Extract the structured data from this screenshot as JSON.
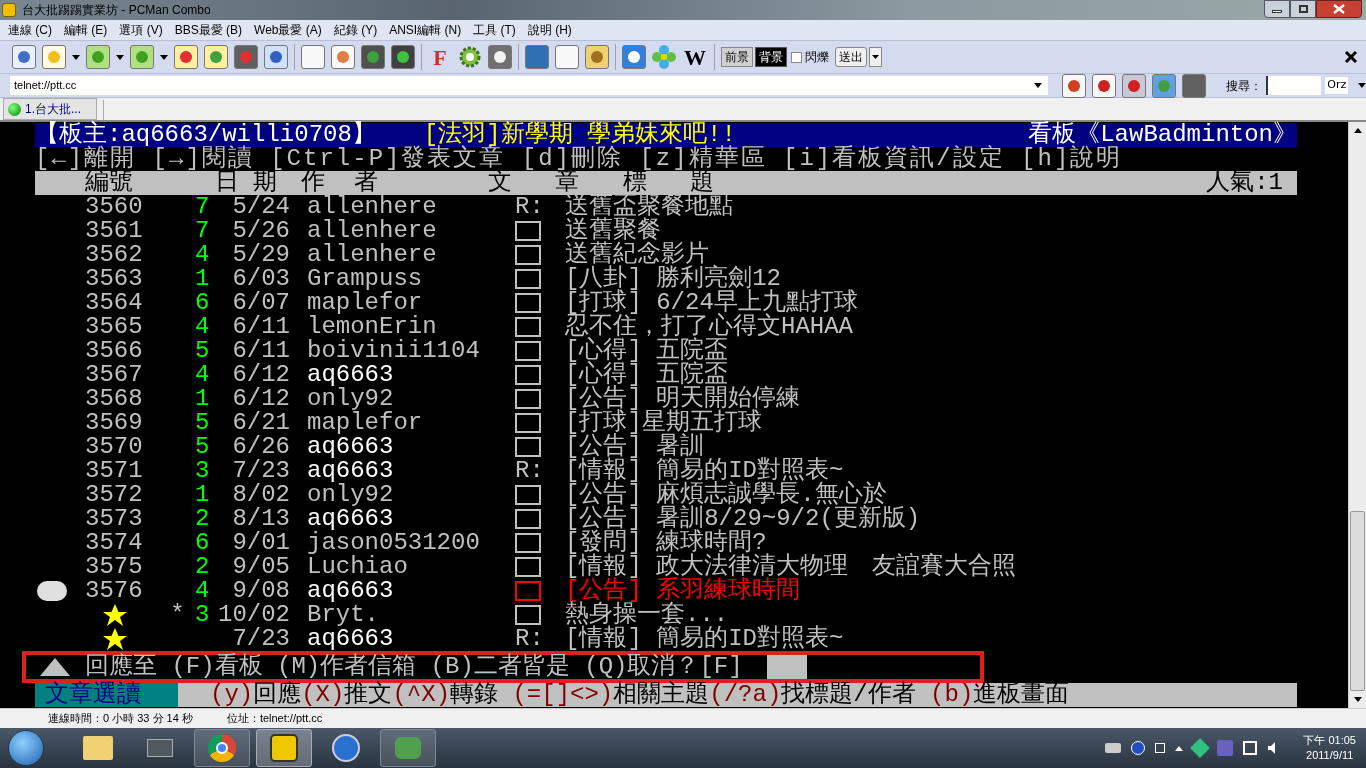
{
  "window": {
    "title": "台大批踢踢實業坊 - PCMan Combo"
  },
  "menu": [
    "連線 (C)",
    "編輯 (E)",
    "選項 (V)",
    "BBS最愛 (B)",
    "Web最愛 (A)",
    "紀錄 (Y)",
    "ANSI編輯 (N)",
    "工具 (T)",
    "說明 (H)"
  ],
  "toolbar": {
    "font_letter": "F",
    "wiki_letter": "W",
    "color_buttons": [
      {
        "label": "前景",
        "selected": false
      },
      {
        "label": "背景",
        "selected": true
      }
    ],
    "blink": {
      "label": "閃爍",
      "checked": false
    },
    "send_button": "送出"
  },
  "address_bar": {
    "value": "telnet://ptt.cc"
  },
  "search": {
    "label": "搜尋：",
    "engine": "Orz"
  },
  "tabs": [
    {
      "label": "1.台大批...",
      "selected": true
    }
  ],
  "terminal": {
    "header": {
      "moderators": "【板主:aq6663/willi0708】",
      "board_title": "[法羽]新學期 學弟妹來吧!!",
      "board_name": "看板《LawBadminton》"
    },
    "commands": "[←]離開 [→]閱讀 [Ctrl-P]發表文章 [d]刪除 [z]精華區 [i]看板資訊/設定 [h]說明",
    "columns": [
      "編號",
      "日 期",
      "作  者",
      "文   章   標   題"
    ],
    "popularity": "人氣:1",
    "rows": [
      {
        "number": "3560",
        "push": "7",
        "date": "5/24",
        "author": "allenhere",
        "kind": "reply",
        "prefix": "R:",
        "title": "送舊盃聚餐地點",
        "selected": false,
        "pinned": false,
        "bright": false,
        "color": "#c0c0c0"
      },
      {
        "number": "3561",
        "push": "7",
        "date": "5/26",
        "author": "allenhere",
        "kind": "post",
        "title": "送舊聚餐",
        "selected": false,
        "pinned": false,
        "bright": false,
        "color": "#c0c0c0"
      },
      {
        "number": "3562",
        "push": "4",
        "date": "5/29",
        "author": "allenhere",
        "kind": "post",
        "title": "送舊紀念影片",
        "selected": false,
        "pinned": false,
        "bright": false,
        "color": "#c0c0c0"
      },
      {
        "number": "3563",
        "push": "1",
        "date": "6/03",
        "author": "Grampuss",
        "kind": "post",
        "title": "[八卦] 勝利亮劍12",
        "selected": false,
        "pinned": false,
        "bright": false,
        "color": "#c0c0c0"
      },
      {
        "number": "3564",
        "push": "6",
        "date": "6/07",
        "author": "maplefor",
        "kind": "post",
        "title": "[打球] 6/24早上九點打球",
        "selected": false,
        "pinned": false,
        "bright": false,
        "color": "#c0c0c0"
      },
      {
        "number": "3565",
        "push": "4",
        "date": "6/11",
        "author": "lemonErin",
        "kind": "post",
        "title": "忍不住，打了心得文HAHAA",
        "selected": false,
        "pinned": false,
        "bright": false,
        "color": "#c0c0c0"
      },
      {
        "number": "3566",
        "push": "5",
        "date": "6/11",
        "author": "boivinii1104",
        "kind": "post",
        "title": "[心得] 五院盃",
        "selected": false,
        "pinned": false,
        "bright": false,
        "color": "#c0c0c0"
      },
      {
        "number": "3567",
        "push": "4",
        "date": "6/12",
        "author": "aq6663",
        "kind": "post",
        "title": "[心得] 五院盃",
        "selected": false,
        "pinned": false,
        "bright": true,
        "color": "#c0c0c0"
      },
      {
        "number": "3568",
        "push": "1",
        "date": "6/12",
        "author": "only92",
        "kind": "post",
        "title": "[公告] 明天開始停練",
        "selected": false,
        "pinned": false,
        "bright": false,
        "color": "#c0c0c0"
      },
      {
        "number": "3569",
        "push": "5",
        "date": "6/21",
        "author": "maplefor",
        "kind": "post",
        "title": "[打球]星期五打球",
        "selected": false,
        "pinned": false,
        "bright": false,
        "color": "#c0c0c0"
      },
      {
        "number": "3570",
        "push": "5",
        "date": "6/26",
        "author": "aq6663",
        "kind": "post",
        "title": "[公告] 暑訓",
        "selected": false,
        "pinned": false,
        "bright": true,
        "color": "#c0c0c0"
      },
      {
        "number": "3571",
        "push": "3",
        "date": "7/23",
        "author": "aq6663",
        "kind": "reply",
        "prefix": "R:",
        "title": "[情報] 簡易的ID對照表~",
        "selected": false,
        "pinned": false,
        "bright": true,
        "color": "#c0c0c0"
      },
      {
        "number": "3572",
        "push": "1",
        "date": "8/02",
        "author": "only92",
        "kind": "post",
        "title": "[公告] 麻煩志誠學長.無心於",
        "selected": false,
        "pinned": false,
        "bright": false,
        "color": "#c0c0c0"
      },
      {
        "number": "3573",
        "push": "2",
        "date": "8/13",
        "author": "aq6663",
        "kind": "post",
        "title": "[公告] 暑訓8/29~9/2(更新版)",
        "selected": false,
        "pinned": false,
        "bright": true,
        "color": "#c0c0c0"
      },
      {
        "number": "3574",
        "push": "6",
        "date": "9/01",
        "author": "jason0531200",
        "kind": "post",
        "title": "[發問] 練球時間?",
        "selected": false,
        "pinned": false,
        "bright": false,
        "color": "#c0c0c0"
      },
      {
        "number": "3575",
        "push": "2",
        "date": "9/05",
        "author": "Luchiao",
        "kind": "post",
        "title": "[情報] 政大法律清大物理　友誼賽大合照",
        "selected": false,
        "pinned": false,
        "bright": false,
        "color": "#c0c0c0"
      },
      {
        "number": "3576",
        "push": "4",
        "date": "9/08",
        "author": "aq6663",
        "kind": "post",
        "title": "[公告] 系羽練球時間",
        "selected": true,
        "pinned": false,
        "bright": true,
        "color": "#ff0000"
      },
      {
        "flag": "*",
        "push": "3",
        "date": "10/02",
        "author": "Bryt.",
        "kind": "post",
        "title": "熱身操一套...",
        "selected": false,
        "pinned": true,
        "bright": false,
        "color": "#c0c0c0"
      },
      {
        "date": "7/23",
        "author": "aq6663",
        "kind": "reply",
        "prefix": "R:",
        "title": "[情報] 簡易的ID對照表~",
        "selected": false,
        "pinned": true,
        "bright": true,
        "color": "#c0c0c0"
      }
    ],
    "prompt": "回應至 (F)看板 (M)作者信箱 (B)二者皆是 (Q)取消？[F]",
    "footer": {
      "mode": "文章選讀",
      "segments": [
        {
          "text": "(y)",
          "key": true
        },
        {
          "text": "回應",
          "key": false
        },
        {
          "text": "(X)",
          "key": true
        },
        {
          "text": "推文",
          "key": false
        },
        {
          "text": "(^X)",
          "key": true
        },
        {
          "text": "轉錄 ",
          "key": false
        },
        {
          "text": "(=[]<>)",
          "key": true
        },
        {
          "text": "相關主題",
          "key": false
        },
        {
          "text": "(/?a)",
          "key": true
        },
        {
          "text": "找標題/作者 ",
          "key": false
        },
        {
          "text": "(b)",
          "key": true
        },
        {
          "text": "進板畫面",
          "key": false
        }
      ]
    }
  },
  "status_bar": {
    "connection_time": "連線時間：0 小時 33 分 14 秒",
    "address": "位址：telnet://ptt.cc"
  },
  "taskbar": {
    "time": "下午 01:05",
    "date": "2011/9/11"
  }
}
